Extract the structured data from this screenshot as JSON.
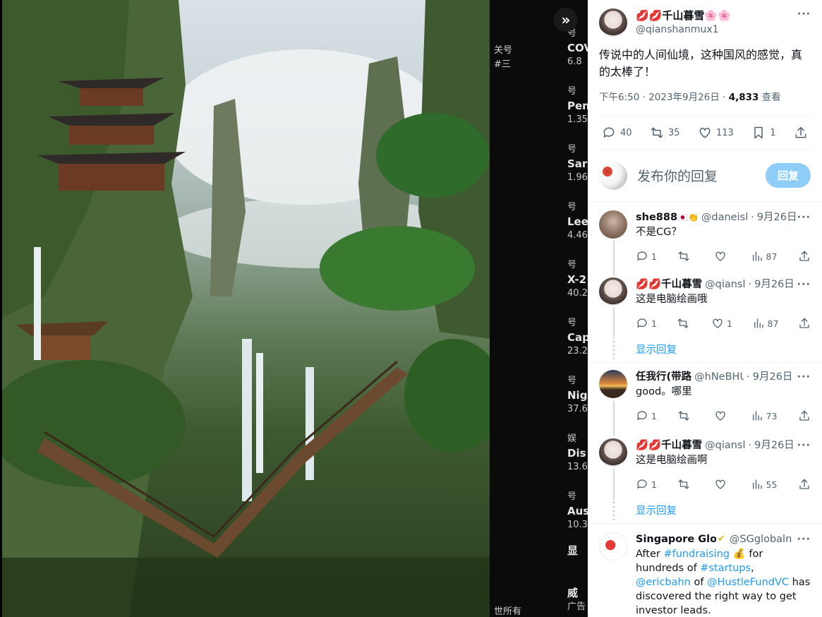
{
  "expand_label": "»",
  "background": {
    "side_labels": [
      "关号",
      "#三",
      "世所有"
    ],
    "blocks": [
      {
        "top": "号",
        "title": "COV",
        "sub": "6.8"
      },
      {
        "top": "号",
        "title": "Pen",
        "sub": "1.35"
      },
      {
        "top": "号",
        "title": "Sar",
        "sub": "1.96"
      },
      {
        "top": "号",
        "title": "Lee",
        "sub": "4.46"
      },
      {
        "top": "号",
        "title": "X-2",
        "sub": "40.2"
      },
      {
        "top": "号",
        "title": "Cap",
        "sub": "23.2"
      },
      {
        "top": "号",
        "title": "Nig",
        "sub": "37.6"
      },
      {
        "top": "娱",
        "title": "Dis",
        "sub": "13.6"
      },
      {
        "top": "号",
        "title": "Aus",
        "sub": "10.3"
      },
      {
        "top": "",
        "title": "显",
        "sub": ""
      },
      {
        "top": "",
        "title": "威",
        "sub": "广告"
      }
    ]
  },
  "post": {
    "display_name": "千山暮雪",
    "name_prefix_emoji": "💋💋",
    "name_suffix_emoji": "🌸🌸",
    "handle": "@qianshanmux1",
    "text": "传说中的人间仙境，这种国风的感觉，真的太棒了！",
    "time": "下午6:50 · 2023年9月26日 · ",
    "views": "4,833",
    "views_label": " 查看",
    "replies": "40",
    "reposts": "35",
    "likes": "113",
    "bookmarks": "1",
    "more": "···"
  },
  "reply_box": {
    "placeholder": "发布你的回复",
    "button": "回复"
  },
  "replies": [
    {
      "name": "she888",
      "emoji": "🇯🇵👏",
      "handle": "@daneisl",
      "date": "9月26日",
      "text": "不是CG？",
      "replies": "1",
      "reposts": "",
      "likes": "",
      "views": "87",
      "avatar": "#8a7060"
    },
    {
      "name": "💋💋千山暮雪",
      "emoji": "",
      "handle": "@qiansl",
      "date": "9月26日",
      "text": "这是电脑绘画哦",
      "replies": "1",
      "reposts": "",
      "likes": "1",
      "views": "87",
      "avatar": "#d9c8c3"
    },
    {
      "name": "任我行(带路",
      "emoji": "",
      "handle": "@hNeBHU",
      "date": "9月26日",
      "text": "good。哪里",
      "replies": "1",
      "reposts": "",
      "likes": "",
      "views": "73",
      "avatar": "#e08b3a"
    },
    {
      "name": "💋💋千山暮雪",
      "emoji": "",
      "handle": "@qiansl",
      "date": "9月26日",
      "text": "这是电脑绘画啊",
      "replies": "1",
      "reposts": "",
      "likes": "",
      "views": "55",
      "avatar": "#d9c8c3"
    }
  ],
  "show_replies": "显示回复",
  "ad": {
    "name": "Singapore Glob",
    "handle": "@SGglobaln",
    "text_parts": [
      "After ",
      "#fundraising",
      " 💰 for hundreds of ",
      "#startups",
      ", ",
      "@ericbahn",
      " of ",
      "@HustleFundVC",
      " has discovered the right way to get investor leads."
    ]
  }
}
